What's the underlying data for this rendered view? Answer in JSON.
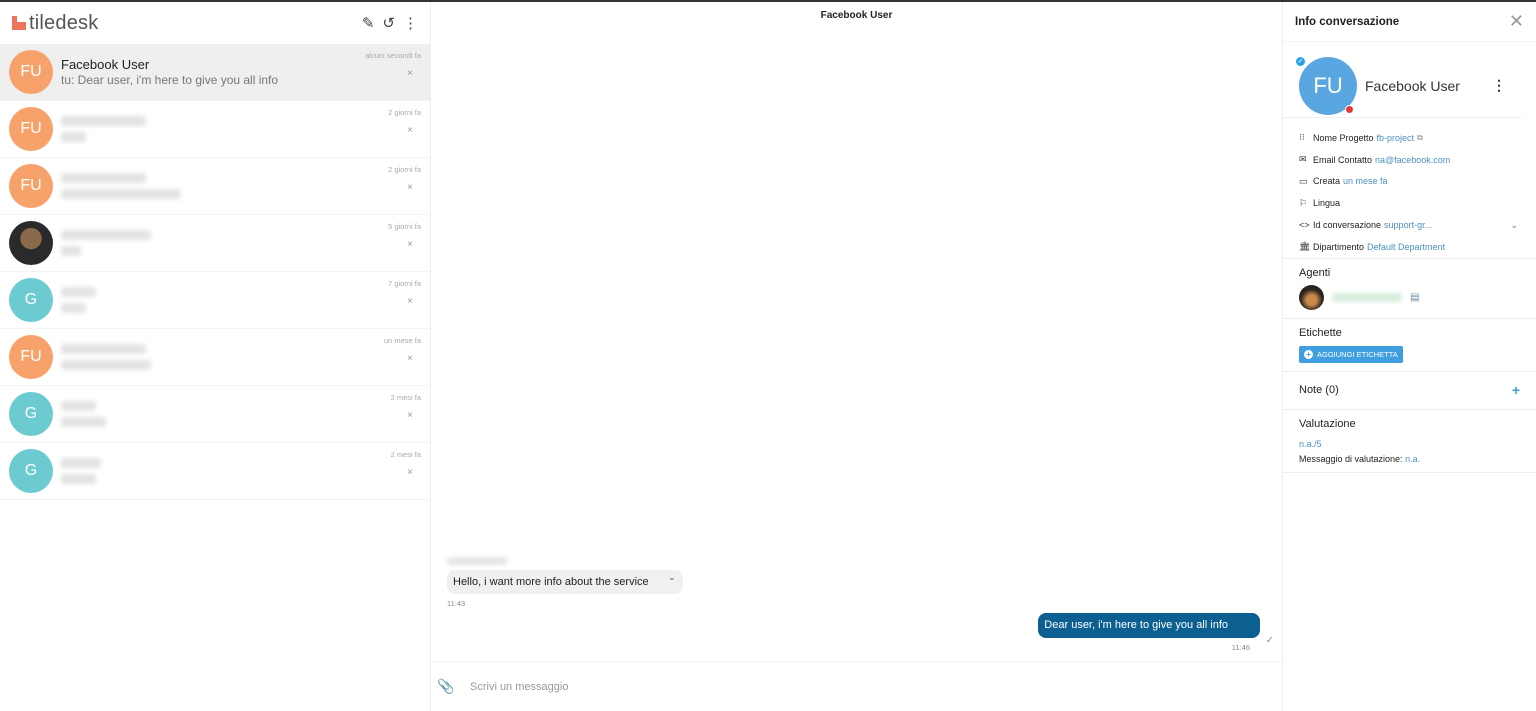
{
  "sidebar": {
    "logo_text": "tiledesk",
    "actions": {
      "edit_icon": "✎",
      "history_icon": "↺",
      "more_icon": "⋮"
    },
    "conversations": [
      {
        "initials": "FU",
        "color": "orange",
        "name": "Facebook User",
        "last_message": "tu: Dear user, i'm here to give you all info",
        "time": "alcuni secondi fa",
        "active": true
      },
      {
        "initials": "FU",
        "color": "orange",
        "name": "",
        "last_message": "",
        "time": "2 giorni fa",
        "active": false
      },
      {
        "initials": "FU",
        "color": "orange",
        "name": "",
        "last_message": "",
        "time": "2 giorni fa",
        "active": false
      },
      {
        "initials": "",
        "color": "photo",
        "name": "",
        "last_message": "",
        "time": "5 giorni fa",
        "active": false
      },
      {
        "initials": "G",
        "color": "teal",
        "name": "",
        "last_message": "",
        "time": "7 giorni fa",
        "active": false
      },
      {
        "initials": "FU",
        "color": "orange",
        "name": "",
        "last_message": "",
        "time": "un mese fa",
        "active": false
      },
      {
        "initials": "G",
        "color": "teal",
        "name": "",
        "last_message": "",
        "time": "2 mesi fa",
        "active": false
      },
      {
        "initials": "G",
        "color": "teal",
        "name": "",
        "last_message": "",
        "time": "2 mesi fa",
        "active": false
      }
    ],
    "close_glyph": "×"
  },
  "chat": {
    "title": "Facebook User",
    "messages": [
      {
        "direction": "in",
        "text": "Hello, i want more info about the service",
        "time": "11:43"
      },
      {
        "direction": "out",
        "text": "Dear user, i'm here to give you all info",
        "time": "11:46",
        "status": "sent"
      }
    ],
    "composer": {
      "placeholder": "Scrivi un messaggio",
      "value": ""
    }
  },
  "info": {
    "title": "Info conversazione",
    "profile": {
      "initials": "FU",
      "name": "Facebook User"
    },
    "details": [
      {
        "icon": "grid-icon",
        "glyph": "⁝⁝⁝",
        "label": "Nome Progetto",
        "value": "fb-project",
        "external": true
      },
      {
        "icon": "email-icon",
        "glyph": "✉",
        "label": "Email Contatto",
        "value": "na@facebook.com"
      },
      {
        "icon": "calendar-icon",
        "glyph": "▭",
        "label": "Creata",
        "value": "un mese fa"
      },
      {
        "icon": "flag-icon",
        "glyph": "⚐",
        "label": "Lingua",
        "value": ""
      },
      {
        "icon": "code-icon",
        "glyph": "<>",
        "label": "Id conversazione",
        "value": "support-gr...",
        "expandable": true
      },
      {
        "icon": "bank-icon",
        "glyph": "🏛",
        "label": "Dipartimento",
        "value": "Default Department"
      }
    ],
    "agents_title": "Agenti",
    "labels_title": "Etichette",
    "add_label_button": "AGGIUNGI ETICHETTA",
    "notes_title": "Note (0)",
    "rating_title": "Valutazione",
    "rating_value": "n.a./5",
    "rating_message_label": "Messaggio di valutazione:",
    "rating_message_value": "n.a."
  },
  "colors": {
    "brand": "#f0735b",
    "avatar_orange": "#f8a26b",
    "avatar_teal": "#6ccad1",
    "outgoing_bubble": "#0c6091",
    "accent_blue": "#3f9ee0",
    "link_blue": "#4a90c2"
  }
}
